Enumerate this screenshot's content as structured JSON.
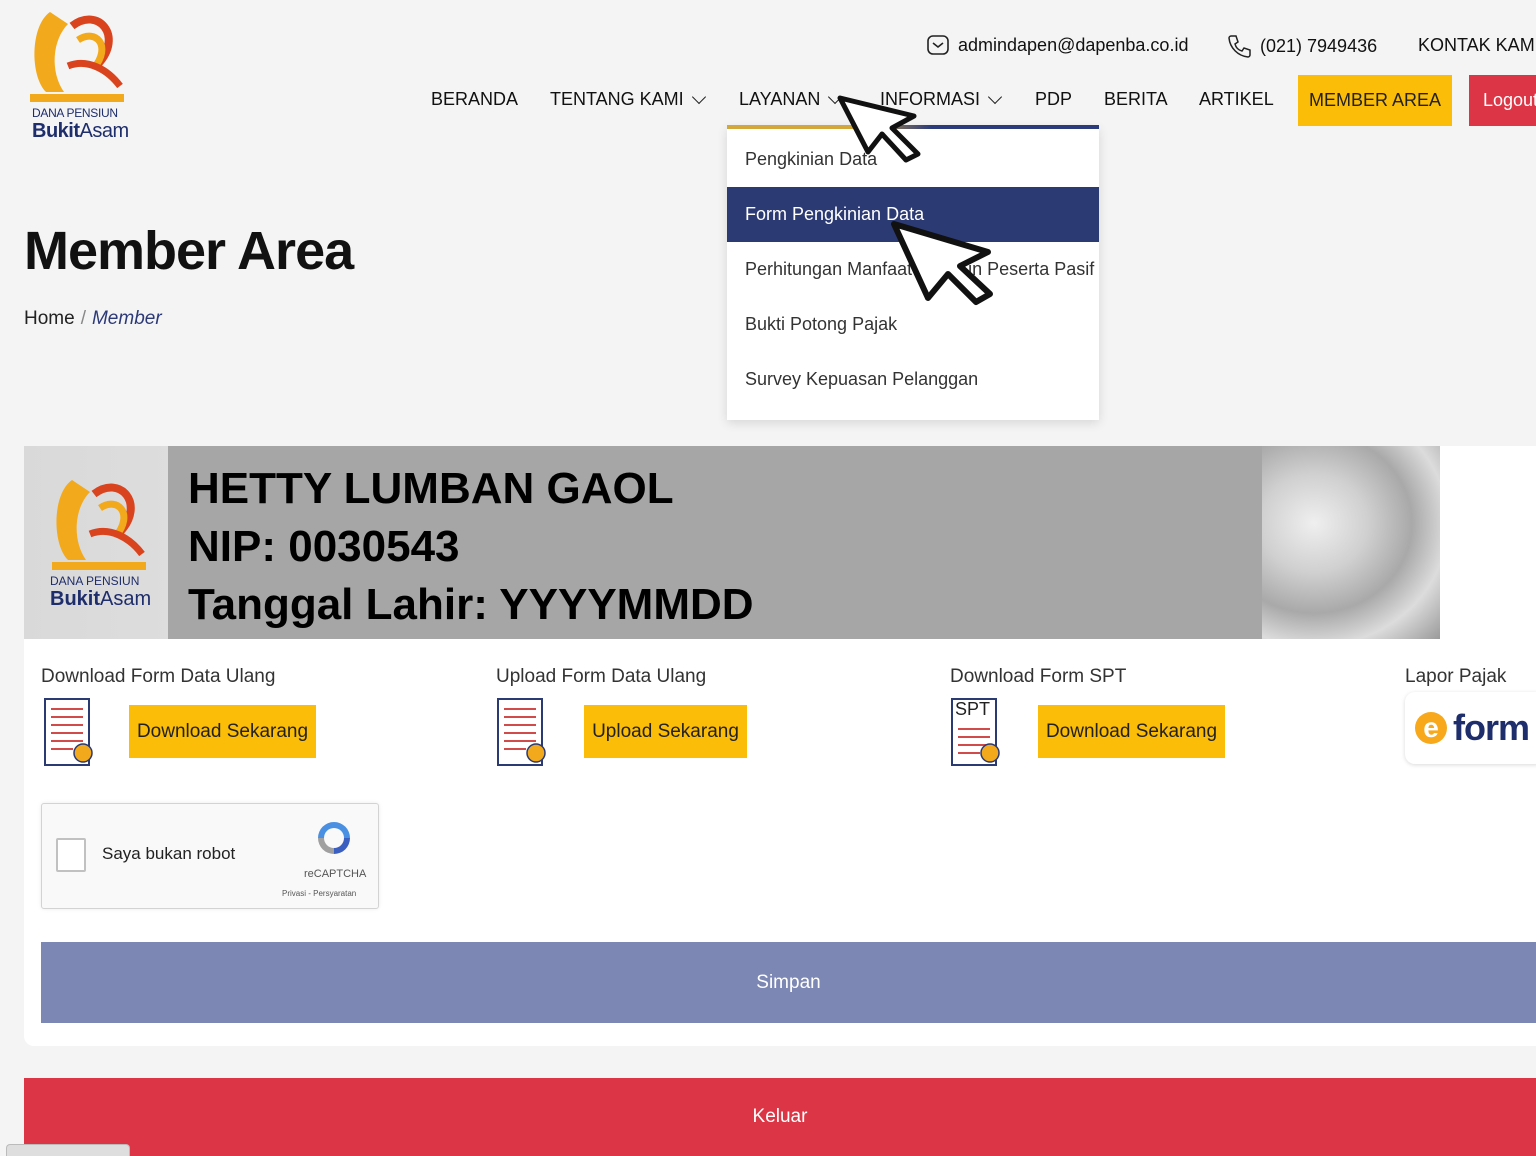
{
  "header": {
    "logo_small": "DANA PENSIUN",
    "logo_big_bold": "Bukit",
    "logo_big_rest": "Asam",
    "email": "admindapen@dapenba.co.id",
    "phone": "(021) 7949436",
    "contact": "KONTAK KAMI"
  },
  "nav": {
    "beranda": "BERANDA",
    "tentang_kami": "TENTANG KAMI",
    "layanan": "LAYANAN",
    "informasi": "INFORMASI",
    "pdp": "PDP",
    "berita": "BERITA",
    "artikel": "ARTIKEL",
    "member_area": "MEMBER AREA",
    "logout": "Logout"
  },
  "dropdown": {
    "items": [
      "Pengkinian Data",
      "Form Pengkinian Data",
      "Perhitungan Manfaat Pensiun Peserta Pasif",
      "Bukti Potong Pajak",
      "Survey Kepuasan Pelanggan"
    ],
    "active_index": 1
  },
  "page": {
    "title": "Member Area",
    "breadcrumb_home": "Home",
    "breadcrumb_sep": "/",
    "breadcrumb_current": "Member"
  },
  "member_info": {
    "name": "HETTY LUMBAN GAOL",
    "nip": "NIP: 0030543",
    "dob": "Tanggal Lahir: YYYYMMDD"
  },
  "actions": {
    "download_form_label": "Download Form Data Ulang",
    "download_form_button": "Download Sekarang",
    "upload_form_label": "Upload Form Data Ulang",
    "upload_form_button": "Upload Sekarang",
    "download_spt_label": "Download Form SPT",
    "download_spt_button": "Download Sekarang",
    "spt_icon_text": "SPT",
    "lapor_pajak_label": "Lapor Pajak",
    "eform_e": "e",
    "eform_text": "form"
  },
  "recaptcha": {
    "label": "Saya bukan robot",
    "brand": "reCAPTCHA",
    "terms": "Privasi - Persyaratan"
  },
  "buttons": {
    "save": "Simpan",
    "exit": "Keluar"
  },
  "colors": {
    "accent_yellow": "#fbbd08",
    "danger_red": "#dc3545",
    "navy": "#2c3a73",
    "save_blue": "#7d87b3"
  }
}
